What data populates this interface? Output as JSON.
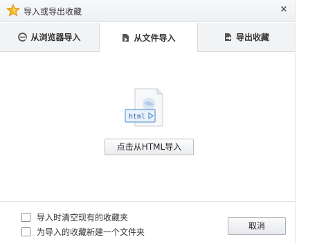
{
  "title": "导入或导出收藏",
  "close_symbol": "×",
  "tabs": [
    {
      "label": "从浏览器导入",
      "icon": "browser-e-icon",
      "active": false
    },
    {
      "label": "从文件导入",
      "icon": "file-import-icon",
      "active": true
    },
    {
      "label": "导出收藏",
      "icon": "file-export-icon",
      "active": false
    }
  ],
  "file_icon_label": "html",
  "import_button_label": "点击从HTML导入",
  "options": [
    {
      "label": "导入时清空现有的收藏夹",
      "checked": false
    },
    {
      "label": "为导入的收藏新建一个文件夹",
      "checked": false
    }
  ],
  "cancel_label": "取消",
  "colors": {
    "accent": "#3d7fc6",
    "star": "#f2b318"
  }
}
